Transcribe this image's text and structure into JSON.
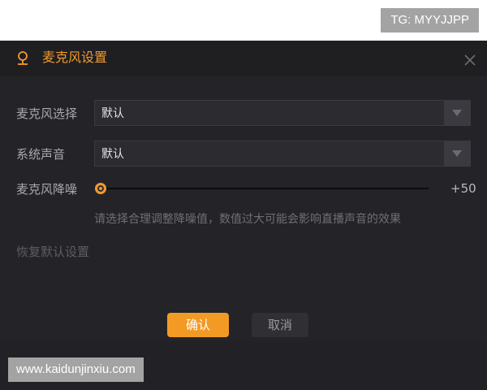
{
  "watermarks": {
    "top": "TG: MYYJJPP",
    "bottom": "www.kaidunjinxiu.com"
  },
  "dialog": {
    "title": "麦克风设置",
    "title_icon": "microphone-icon",
    "close_icon": "close-icon",
    "accent_color": "#f19a2d"
  },
  "mic_select": {
    "label": "麦克风选择",
    "value": "默认"
  },
  "system_sound": {
    "label": "系统声音",
    "value": "默认"
  },
  "noise_reduction": {
    "label": "麦克风降噪",
    "value_text": "+50",
    "level": 0,
    "hint": "请选择合理调整降噪值，数值过大可能会影响直播声音的效果"
  },
  "restore_defaults": "恢复默认设置",
  "buttons": {
    "ok": "确认",
    "cancel": "取消"
  }
}
